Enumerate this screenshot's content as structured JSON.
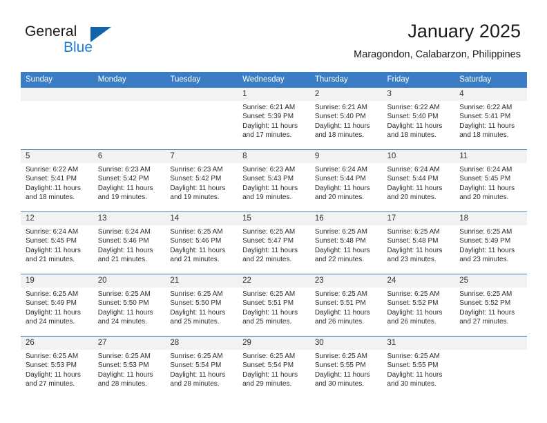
{
  "brand": {
    "name_part1": "General",
    "name_part2": "Blue",
    "logo_icon": "triangle-logo-icon"
  },
  "header": {
    "title": "January 2025",
    "subtitle": "Maragondon, Calabarzon, Philippines"
  },
  "colors": {
    "header_blue": "#3b7dc4",
    "daynum_gray": "#f2f2f2",
    "brand_blue": "#1e7fd4",
    "logo_blue": "#1464aa",
    "text": "#2b2b2b"
  },
  "labels": {
    "sunrise": "Sunrise:",
    "sunset": "Sunset:",
    "daylight": "Daylight:"
  },
  "weekdays": [
    "Sunday",
    "Monday",
    "Tuesday",
    "Wednesday",
    "Thursday",
    "Friday",
    "Saturday"
  ],
  "weeks": [
    [
      {
        "day": "",
        "sunrise": "",
        "sunset": "",
        "daylight_line1": "",
        "daylight_line2": ""
      },
      {
        "day": "",
        "sunrise": "",
        "sunset": "",
        "daylight_line1": "",
        "daylight_line2": ""
      },
      {
        "day": "",
        "sunrise": "",
        "sunset": "",
        "daylight_line1": "",
        "daylight_line2": ""
      },
      {
        "day": "1",
        "sunrise": "Sunrise: 6:21 AM",
        "sunset": "Sunset: 5:39 PM",
        "daylight_line1": "Daylight: 11 hours",
        "daylight_line2": "and 17 minutes."
      },
      {
        "day": "2",
        "sunrise": "Sunrise: 6:21 AM",
        "sunset": "Sunset: 5:40 PM",
        "daylight_line1": "Daylight: 11 hours",
        "daylight_line2": "and 18 minutes."
      },
      {
        "day": "3",
        "sunrise": "Sunrise: 6:22 AM",
        "sunset": "Sunset: 5:40 PM",
        "daylight_line1": "Daylight: 11 hours",
        "daylight_line2": "and 18 minutes."
      },
      {
        "day": "4",
        "sunrise": "Sunrise: 6:22 AM",
        "sunset": "Sunset: 5:41 PM",
        "daylight_line1": "Daylight: 11 hours",
        "daylight_line2": "and 18 minutes."
      }
    ],
    [
      {
        "day": "5",
        "sunrise": "Sunrise: 6:22 AM",
        "sunset": "Sunset: 5:41 PM",
        "daylight_line1": "Daylight: 11 hours",
        "daylight_line2": "and 18 minutes."
      },
      {
        "day": "6",
        "sunrise": "Sunrise: 6:23 AM",
        "sunset": "Sunset: 5:42 PM",
        "daylight_line1": "Daylight: 11 hours",
        "daylight_line2": "and 19 minutes."
      },
      {
        "day": "7",
        "sunrise": "Sunrise: 6:23 AM",
        "sunset": "Sunset: 5:42 PM",
        "daylight_line1": "Daylight: 11 hours",
        "daylight_line2": "and 19 minutes."
      },
      {
        "day": "8",
        "sunrise": "Sunrise: 6:23 AM",
        "sunset": "Sunset: 5:43 PM",
        "daylight_line1": "Daylight: 11 hours",
        "daylight_line2": "and 19 minutes."
      },
      {
        "day": "9",
        "sunrise": "Sunrise: 6:24 AM",
        "sunset": "Sunset: 5:44 PM",
        "daylight_line1": "Daylight: 11 hours",
        "daylight_line2": "and 20 minutes."
      },
      {
        "day": "10",
        "sunrise": "Sunrise: 6:24 AM",
        "sunset": "Sunset: 5:44 PM",
        "daylight_line1": "Daylight: 11 hours",
        "daylight_line2": "and 20 minutes."
      },
      {
        "day": "11",
        "sunrise": "Sunrise: 6:24 AM",
        "sunset": "Sunset: 5:45 PM",
        "daylight_line1": "Daylight: 11 hours",
        "daylight_line2": "and 20 minutes."
      }
    ],
    [
      {
        "day": "12",
        "sunrise": "Sunrise: 6:24 AM",
        "sunset": "Sunset: 5:45 PM",
        "daylight_line1": "Daylight: 11 hours",
        "daylight_line2": "and 21 minutes."
      },
      {
        "day": "13",
        "sunrise": "Sunrise: 6:24 AM",
        "sunset": "Sunset: 5:46 PM",
        "daylight_line1": "Daylight: 11 hours",
        "daylight_line2": "and 21 minutes."
      },
      {
        "day": "14",
        "sunrise": "Sunrise: 6:25 AM",
        "sunset": "Sunset: 5:46 PM",
        "daylight_line1": "Daylight: 11 hours",
        "daylight_line2": "and 21 minutes."
      },
      {
        "day": "15",
        "sunrise": "Sunrise: 6:25 AM",
        "sunset": "Sunset: 5:47 PM",
        "daylight_line1": "Daylight: 11 hours",
        "daylight_line2": "and 22 minutes."
      },
      {
        "day": "16",
        "sunrise": "Sunrise: 6:25 AM",
        "sunset": "Sunset: 5:48 PM",
        "daylight_line1": "Daylight: 11 hours",
        "daylight_line2": "and 22 minutes."
      },
      {
        "day": "17",
        "sunrise": "Sunrise: 6:25 AM",
        "sunset": "Sunset: 5:48 PM",
        "daylight_line1": "Daylight: 11 hours",
        "daylight_line2": "and 23 minutes."
      },
      {
        "day": "18",
        "sunrise": "Sunrise: 6:25 AM",
        "sunset": "Sunset: 5:49 PM",
        "daylight_line1": "Daylight: 11 hours",
        "daylight_line2": "and 23 minutes."
      }
    ],
    [
      {
        "day": "19",
        "sunrise": "Sunrise: 6:25 AM",
        "sunset": "Sunset: 5:49 PM",
        "daylight_line1": "Daylight: 11 hours",
        "daylight_line2": "and 24 minutes."
      },
      {
        "day": "20",
        "sunrise": "Sunrise: 6:25 AM",
        "sunset": "Sunset: 5:50 PM",
        "daylight_line1": "Daylight: 11 hours",
        "daylight_line2": "and 24 minutes."
      },
      {
        "day": "21",
        "sunrise": "Sunrise: 6:25 AM",
        "sunset": "Sunset: 5:50 PM",
        "daylight_line1": "Daylight: 11 hours",
        "daylight_line2": "and 25 minutes."
      },
      {
        "day": "22",
        "sunrise": "Sunrise: 6:25 AM",
        "sunset": "Sunset: 5:51 PM",
        "daylight_line1": "Daylight: 11 hours",
        "daylight_line2": "and 25 minutes."
      },
      {
        "day": "23",
        "sunrise": "Sunrise: 6:25 AM",
        "sunset": "Sunset: 5:51 PM",
        "daylight_line1": "Daylight: 11 hours",
        "daylight_line2": "and 26 minutes."
      },
      {
        "day": "24",
        "sunrise": "Sunrise: 6:25 AM",
        "sunset": "Sunset: 5:52 PM",
        "daylight_line1": "Daylight: 11 hours",
        "daylight_line2": "and 26 minutes."
      },
      {
        "day": "25",
        "sunrise": "Sunrise: 6:25 AM",
        "sunset": "Sunset: 5:52 PM",
        "daylight_line1": "Daylight: 11 hours",
        "daylight_line2": "and 27 minutes."
      }
    ],
    [
      {
        "day": "26",
        "sunrise": "Sunrise: 6:25 AM",
        "sunset": "Sunset: 5:53 PM",
        "daylight_line1": "Daylight: 11 hours",
        "daylight_line2": "and 27 minutes."
      },
      {
        "day": "27",
        "sunrise": "Sunrise: 6:25 AM",
        "sunset": "Sunset: 5:53 PM",
        "daylight_line1": "Daylight: 11 hours",
        "daylight_line2": "and 28 minutes."
      },
      {
        "day": "28",
        "sunrise": "Sunrise: 6:25 AM",
        "sunset": "Sunset: 5:54 PM",
        "daylight_line1": "Daylight: 11 hours",
        "daylight_line2": "and 28 minutes."
      },
      {
        "day": "29",
        "sunrise": "Sunrise: 6:25 AM",
        "sunset": "Sunset: 5:54 PM",
        "daylight_line1": "Daylight: 11 hours",
        "daylight_line2": "and 29 minutes."
      },
      {
        "day": "30",
        "sunrise": "Sunrise: 6:25 AM",
        "sunset": "Sunset: 5:55 PM",
        "daylight_line1": "Daylight: 11 hours",
        "daylight_line2": "and 30 minutes."
      },
      {
        "day": "31",
        "sunrise": "Sunrise: 6:25 AM",
        "sunset": "Sunset: 5:55 PM",
        "daylight_line1": "Daylight: 11 hours",
        "daylight_line2": "and 30 minutes."
      },
      {
        "day": "",
        "sunrise": "",
        "sunset": "",
        "daylight_line1": "",
        "daylight_line2": ""
      }
    ]
  ]
}
